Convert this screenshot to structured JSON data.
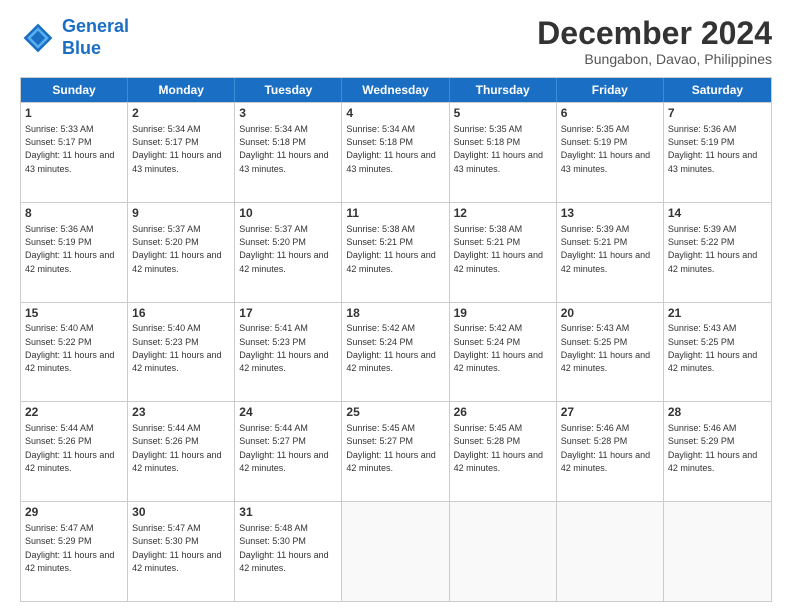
{
  "logo": {
    "line1": "General",
    "line2": "Blue"
  },
  "title": "December 2024",
  "subtitle": "Bungabon, Davao, Philippines",
  "days": [
    "Sunday",
    "Monday",
    "Tuesday",
    "Wednesday",
    "Thursday",
    "Friday",
    "Saturday"
  ],
  "rows": [
    [
      {
        "day": "1",
        "sunrise": "5:33 AM",
        "sunset": "5:17 PM",
        "daylight": "11 hours and 43 minutes."
      },
      {
        "day": "2",
        "sunrise": "5:34 AM",
        "sunset": "5:17 PM",
        "daylight": "11 hours and 43 minutes."
      },
      {
        "day": "3",
        "sunrise": "5:34 AM",
        "sunset": "5:18 PM",
        "daylight": "11 hours and 43 minutes."
      },
      {
        "day": "4",
        "sunrise": "5:34 AM",
        "sunset": "5:18 PM",
        "daylight": "11 hours and 43 minutes."
      },
      {
        "day": "5",
        "sunrise": "5:35 AM",
        "sunset": "5:18 PM",
        "daylight": "11 hours and 43 minutes."
      },
      {
        "day": "6",
        "sunrise": "5:35 AM",
        "sunset": "5:19 PM",
        "daylight": "11 hours and 43 minutes."
      },
      {
        "day": "7",
        "sunrise": "5:36 AM",
        "sunset": "5:19 PM",
        "daylight": "11 hours and 43 minutes."
      }
    ],
    [
      {
        "day": "8",
        "sunrise": "5:36 AM",
        "sunset": "5:19 PM",
        "daylight": "11 hours and 42 minutes."
      },
      {
        "day": "9",
        "sunrise": "5:37 AM",
        "sunset": "5:20 PM",
        "daylight": "11 hours and 42 minutes."
      },
      {
        "day": "10",
        "sunrise": "5:37 AM",
        "sunset": "5:20 PM",
        "daylight": "11 hours and 42 minutes."
      },
      {
        "day": "11",
        "sunrise": "5:38 AM",
        "sunset": "5:21 PM",
        "daylight": "11 hours and 42 minutes."
      },
      {
        "day": "12",
        "sunrise": "5:38 AM",
        "sunset": "5:21 PM",
        "daylight": "11 hours and 42 minutes."
      },
      {
        "day": "13",
        "sunrise": "5:39 AM",
        "sunset": "5:21 PM",
        "daylight": "11 hours and 42 minutes."
      },
      {
        "day": "14",
        "sunrise": "5:39 AM",
        "sunset": "5:22 PM",
        "daylight": "11 hours and 42 minutes."
      }
    ],
    [
      {
        "day": "15",
        "sunrise": "5:40 AM",
        "sunset": "5:22 PM",
        "daylight": "11 hours and 42 minutes."
      },
      {
        "day": "16",
        "sunrise": "5:40 AM",
        "sunset": "5:23 PM",
        "daylight": "11 hours and 42 minutes."
      },
      {
        "day": "17",
        "sunrise": "5:41 AM",
        "sunset": "5:23 PM",
        "daylight": "11 hours and 42 minutes."
      },
      {
        "day": "18",
        "sunrise": "5:42 AM",
        "sunset": "5:24 PM",
        "daylight": "11 hours and 42 minutes."
      },
      {
        "day": "19",
        "sunrise": "5:42 AM",
        "sunset": "5:24 PM",
        "daylight": "11 hours and 42 minutes."
      },
      {
        "day": "20",
        "sunrise": "5:43 AM",
        "sunset": "5:25 PM",
        "daylight": "11 hours and 42 minutes."
      },
      {
        "day": "21",
        "sunrise": "5:43 AM",
        "sunset": "5:25 PM",
        "daylight": "11 hours and 42 minutes."
      }
    ],
    [
      {
        "day": "22",
        "sunrise": "5:44 AM",
        "sunset": "5:26 PM",
        "daylight": "11 hours and 42 minutes."
      },
      {
        "day": "23",
        "sunrise": "5:44 AM",
        "sunset": "5:26 PM",
        "daylight": "11 hours and 42 minutes."
      },
      {
        "day": "24",
        "sunrise": "5:44 AM",
        "sunset": "5:27 PM",
        "daylight": "11 hours and 42 minutes."
      },
      {
        "day": "25",
        "sunrise": "5:45 AM",
        "sunset": "5:27 PM",
        "daylight": "11 hours and 42 minutes."
      },
      {
        "day": "26",
        "sunrise": "5:45 AM",
        "sunset": "5:28 PM",
        "daylight": "11 hours and 42 minutes."
      },
      {
        "day": "27",
        "sunrise": "5:46 AM",
        "sunset": "5:28 PM",
        "daylight": "11 hours and 42 minutes."
      },
      {
        "day": "28",
        "sunrise": "5:46 AM",
        "sunset": "5:29 PM",
        "daylight": "11 hours and 42 minutes."
      }
    ],
    [
      {
        "day": "29",
        "sunrise": "5:47 AM",
        "sunset": "5:29 PM",
        "daylight": "11 hours and 42 minutes."
      },
      {
        "day": "30",
        "sunrise": "5:47 AM",
        "sunset": "5:30 PM",
        "daylight": "11 hours and 42 minutes."
      },
      {
        "day": "31",
        "sunrise": "5:48 AM",
        "sunset": "5:30 PM",
        "daylight": "11 hours and 42 minutes."
      },
      null,
      null,
      null,
      null
    ]
  ]
}
